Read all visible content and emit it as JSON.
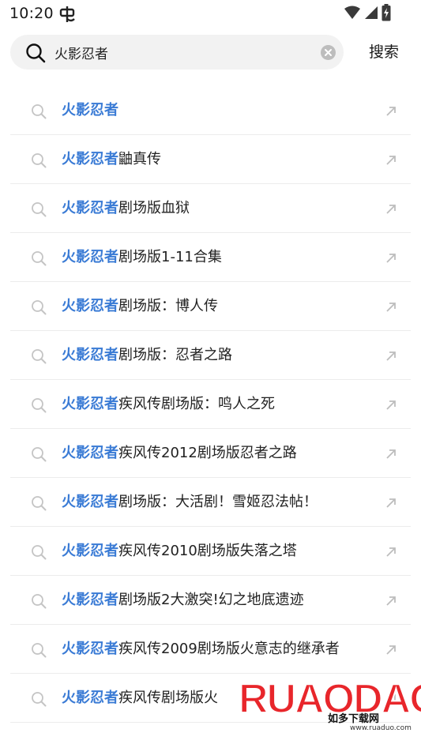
{
  "status_bar": {
    "time": "10:20",
    "icons": [
      "app-notification-icon",
      "wifi-icon",
      "signal-icon",
      "battery-charging-icon"
    ]
  },
  "search": {
    "value": "火影忍者",
    "placeholder": "",
    "button_label": "搜索"
  },
  "highlight_color": "#3a7bd5",
  "suggestions": [
    {
      "highlight": "火影忍者",
      "rest": ""
    },
    {
      "highlight": "火影忍者",
      "rest": "鼬真传"
    },
    {
      "highlight": "火影忍者",
      "rest": "剧场版血狱"
    },
    {
      "highlight": "火影忍者",
      "rest": "剧场版1-11合集"
    },
    {
      "highlight": "火影忍者",
      "rest": "剧场版：博人传"
    },
    {
      "highlight": "火影忍者",
      "rest": "剧场版：忍者之路"
    },
    {
      "highlight": "火影忍者",
      "rest": "疾风传剧场版：鸣人之死"
    },
    {
      "highlight": "火影忍者",
      "rest": "疾风传2012剧场版忍者之路"
    },
    {
      "highlight": "火影忍者",
      "rest": "剧场版：大活剧！雪姬忍法帖！"
    },
    {
      "highlight": "火影忍者",
      "rest": "疾风传2010剧场版失落之塔"
    },
    {
      "highlight": "火影忍者",
      "rest": "剧场版2大激突!幻之地底遗迹"
    },
    {
      "highlight": "火影忍者",
      "rest": "疾风传2009剧场版火意志的继承者"
    },
    {
      "highlight": "火影忍者",
      "rest": "疾风传剧场版火"
    }
  ],
  "watermark": {
    "brand": "RUAODAO",
    "sub1": "如多下载网",
    "sub2": "www.ruaduo.com"
  }
}
